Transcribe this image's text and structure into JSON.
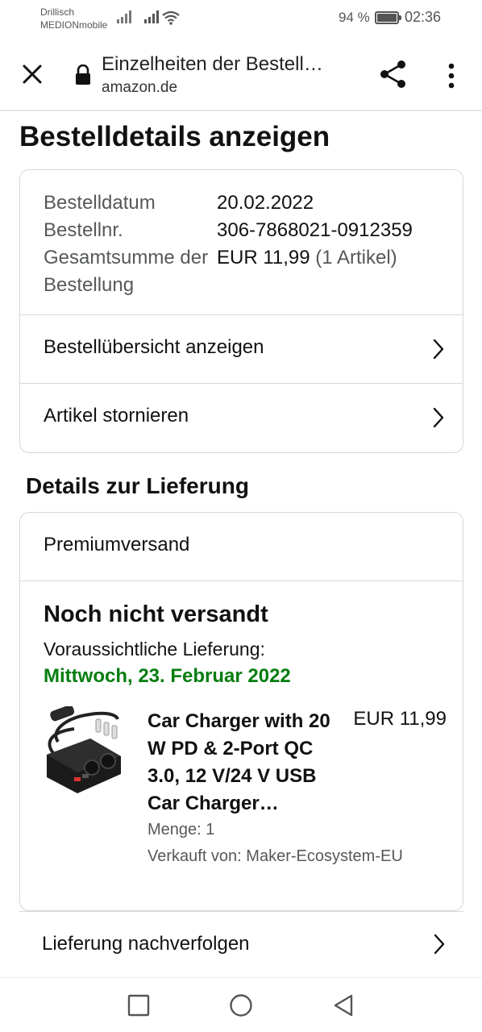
{
  "status_bar": {
    "carrier_line1": "Drillisch",
    "carrier_line2": "MEDIONmobile",
    "battery_percent": "94 %",
    "battery_level": 0.94,
    "time": "02:36"
  },
  "browser": {
    "page_title": "Einzelheiten der Bestell…",
    "url": "amazon.de",
    "icons": [
      "close-icon",
      "lock-icon",
      "share-icon",
      "more-vert-icon"
    ]
  },
  "page": {
    "title": "Bestelldetails anzeigen"
  },
  "order_summary": {
    "rows": [
      {
        "label": "Bestelldatum",
        "value": "20.02.2022"
      },
      {
        "label": "Bestellnr.",
        "value": "306-7868021-0912359"
      },
      {
        "label": "Gesamtsumme der Bestellung",
        "value": "EUR 11,99",
        "extra": "(1 Artikel)"
      }
    ],
    "view_summary_label": "Bestellübersicht anzeigen",
    "cancel_items_label": "Artikel stornieren"
  },
  "delivery": {
    "section_title": "Details zur Lieferung",
    "shipping_method": "Premiumversand",
    "status": "Noch nicht versandt",
    "expected_label": "Voraussichtliche Lieferung:",
    "expected_date": "Mittwoch, 23. Februar 2022",
    "accent_color": "#067d0f",
    "item": {
      "name": "Car Charger with 20 W PD & 2-Port QC 3.0, 12 V/24 V USB Car Charger…",
      "price": "EUR 11,99",
      "quantity": "Menge: 1",
      "seller": "Verkauft von: Maker-Ecosystem-EU"
    },
    "track_label": "Lieferung nachverfolgen"
  },
  "nav": {
    "icons": [
      "recent-apps-icon",
      "home-icon",
      "back-icon"
    ]
  }
}
